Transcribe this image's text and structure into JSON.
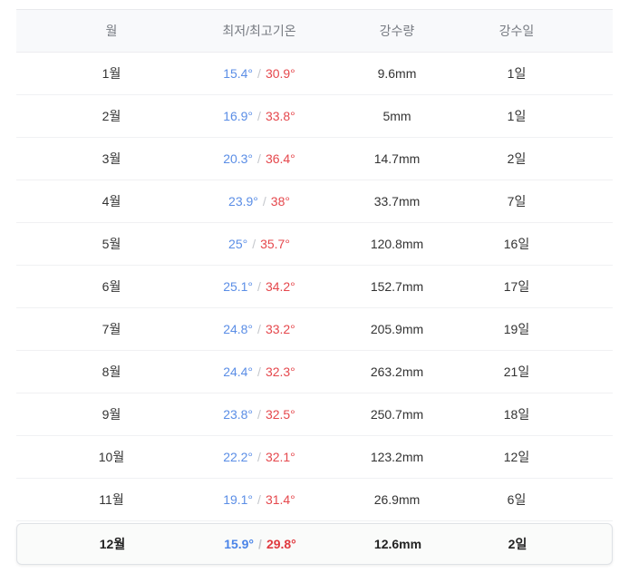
{
  "headers": {
    "month": "월",
    "temp": "최저/최고기온",
    "rain": "강수량",
    "days": "강수일"
  },
  "separator": "/",
  "rows": [
    {
      "month": "1월",
      "low": "15.4°",
      "high": "30.9°",
      "rain": "9.6mm",
      "days": "1일"
    },
    {
      "month": "2월",
      "low": "16.9°",
      "high": "33.8°",
      "rain": "5mm",
      "days": "1일"
    },
    {
      "month": "3월",
      "low": "20.3°",
      "high": "36.4°",
      "rain": "14.7mm",
      "days": "2일"
    },
    {
      "month": "4월",
      "low": "23.9°",
      "high": "38°",
      "rain": "33.7mm",
      "days": "7일"
    },
    {
      "month": "5월",
      "low": "25°",
      "high": "35.7°",
      "rain": "120.8mm",
      "days": "16일"
    },
    {
      "month": "6월",
      "low": "25.1°",
      "high": "34.2°",
      "rain": "152.7mm",
      "days": "17일"
    },
    {
      "month": "7월",
      "low": "24.8°",
      "high": "33.2°",
      "rain": "205.9mm",
      "days": "19일"
    },
    {
      "month": "8월",
      "low": "24.4°",
      "high": "32.3°",
      "rain": "263.2mm",
      "days": "21일"
    },
    {
      "month": "9월",
      "low": "23.8°",
      "high": "32.5°",
      "rain": "250.7mm",
      "days": "18일"
    },
    {
      "month": "10월",
      "low": "22.2°",
      "high": "32.1°",
      "rain": "123.2mm",
      "days": "12일"
    },
    {
      "month": "11월",
      "low": "19.1°",
      "high": "31.4°",
      "rain": "26.9mm",
      "days": "6일"
    },
    {
      "month": "12월",
      "low": "15.9°",
      "high": "29.8°",
      "rain": "12.6mm",
      "days": "2일"
    }
  ],
  "highlighted_row": 11,
  "colors": {
    "low_temp": "#5b8ee6",
    "high_temp": "#e5484d",
    "header_bg": "#f8f9fb",
    "header_text": "#777b82"
  }
}
